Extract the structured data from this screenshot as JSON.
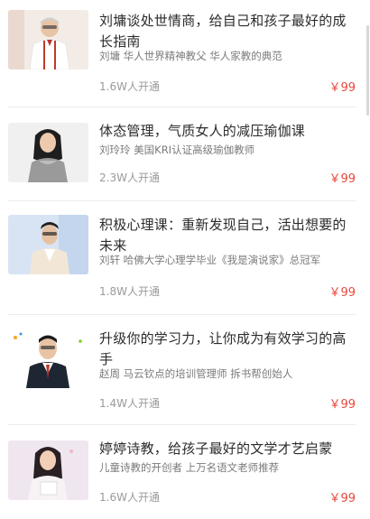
{
  "courses": [
    {
      "title": "刘墉谈处世情商，给自己和孩子最好的成长指南",
      "subtitle": "刘墉 华人世界精神教父 华人家教的典范",
      "subscribers": "1.6W人开通",
      "price": "￥99",
      "thumb_bg": "#f3ece6"
    },
    {
      "title": "体态管理，气质女人的减压瑜伽课",
      "subtitle": "刘玲玲 美国KRI认证高级瑜伽教师",
      "subscribers": "2.3W人开通",
      "price": "￥99",
      "thumb_bg": "#f1f0f0"
    },
    {
      "title": "积极心理课：重新发现自己，活出想要的未来",
      "subtitle": "刘轩 哈佛大学心理学毕业《我是演说家》总冠军",
      "subscribers": "1.8W人开通",
      "price": "￥99",
      "thumb_bg": "#d8e4f4"
    },
    {
      "title": "升级你的学习力，让你成为有效学习的高手",
      "subtitle": "赵周 马云钦点的培训管理师 拆书帮创始人",
      "subscribers": "1.4W人开通",
      "price": "￥99",
      "thumb_bg": "#ffffff"
    },
    {
      "title": "婷婷诗教，给孩子最好的文学才艺启蒙",
      "subtitle": "儿童诗教的开创者 上万名语文老师推荐",
      "subscribers": "1.6W人开通",
      "price": "￥99",
      "thumb_bg": "#efe6f0"
    }
  ],
  "colors": {
    "price": "#e8483d",
    "divider": "#ececec"
  }
}
